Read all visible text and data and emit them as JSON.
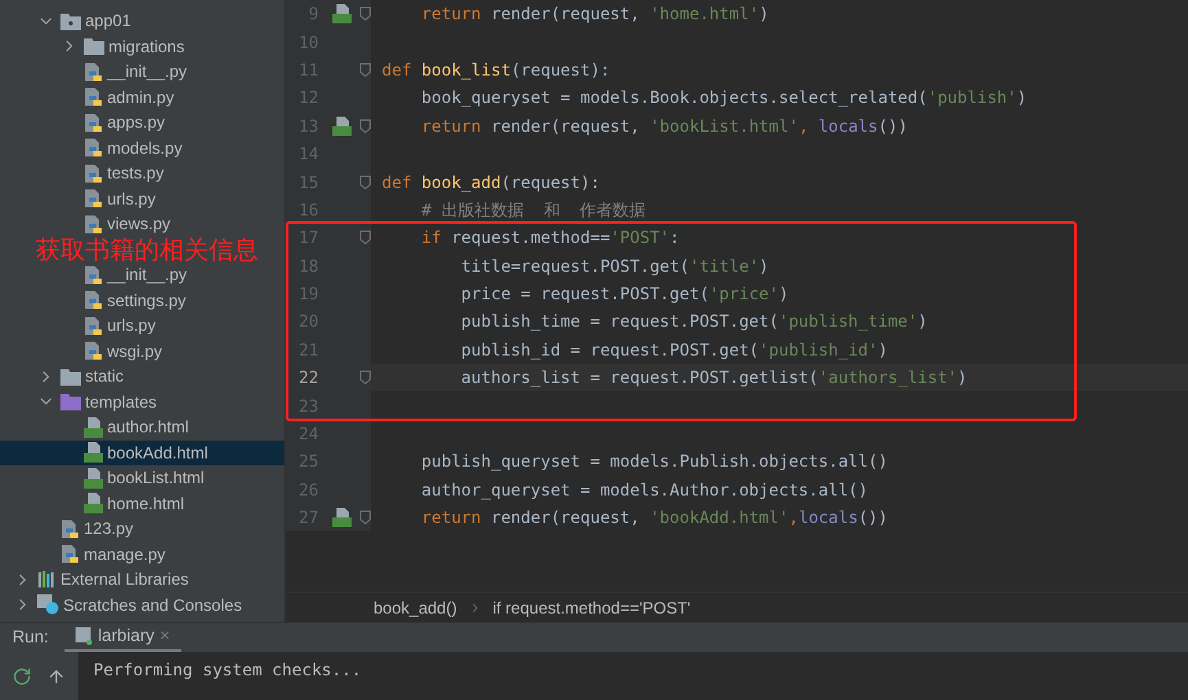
{
  "project_tree": {
    "children": [
      {
        "name": "app01",
        "kind": "package",
        "expanded": true,
        "selected": false,
        "children": [
          {
            "name": "migrations",
            "kind": "folder",
            "expanded": false,
            "selected": false
          },
          {
            "name": "__init__.py",
            "kind": "python",
            "selected": false
          },
          {
            "name": "admin.py",
            "kind": "python",
            "selected": false
          },
          {
            "name": "apps.py",
            "kind": "python",
            "selected": false
          },
          {
            "name": "models.py",
            "kind": "python",
            "selected": false
          },
          {
            "name": "tests.py",
            "kind": "python",
            "selected": false
          },
          {
            "name": "urls.py",
            "kind": "python",
            "selected": false
          },
          {
            "name": "views.py",
            "kind": "python",
            "selected": false
          }
        ]
      },
      {
        "selected": false,
        "annotation": "获取书籍的相关信息",
        "children": [
          {
            "name": "__init__.py",
            "kind": "python",
            "selected": false
          },
          {
            "name": "settings.py",
            "kind": "python",
            "selected": false
          },
          {
            "name": "urls.py",
            "kind": "python",
            "selected": false
          },
          {
            "name": "wsgi.py",
            "kind": "python",
            "selected": false
          }
        ]
      },
      {
        "name": "static",
        "kind": "folder",
        "expanded": false,
        "selected": false
      },
      {
        "name": "templates",
        "kind": "templates",
        "expanded": true,
        "selected": false,
        "children": [
          {
            "name": "author.html",
            "kind": "html",
            "selected": false
          },
          {
            "name": "bookAdd.html",
            "kind": "html",
            "selected": true
          },
          {
            "name": "bookList.html",
            "kind": "html",
            "selected": false
          },
          {
            "name": "home.html",
            "kind": "html",
            "selected": false
          }
        ]
      },
      {
        "name": "123.py",
        "kind": "python",
        "selected": false
      },
      {
        "name": "manage.py",
        "kind": "python",
        "selected": false
      }
    ]
  },
  "extra_roots": [
    {
      "name": "External Libraries",
      "kind": "libraries",
      "expanded": false,
      "selected": false
    },
    {
      "name": "Scratches and Consoles",
      "kind": "scratches",
      "expanded": false,
      "selected": false
    }
  ],
  "editor": {
    "lines": [
      {
        "number": "9",
        "gutter_icon": true,
        "fold": true,
        "current": false,
        "tokens": [
          {
            "text": "    return",
            "kind": "kw"
          },
          {
            "text": " render(request, ",
            "kind": "plain"
          },
          {
            "text": "'home.html'",
            "kind": "str"
          },
          {
            "text": ")",
            "kind": "plain"
          }
        ]
      },
      {
        "number": "10",
        "gutter_icon": false,
        "fold": false,
        "current": false
      },
      {
        "number": "11",
        "gutter_icon": false,
        "fold": true,
        "current": false,
        "tokens": [
          {
            "text": "def ",
            "kind": "kw"
          },
          {
            "text": "book_list",
            "kind": "fn"
          },
          {
            "text": "(request):",
            "kind": "plain"
          }
        ]
      },
      {
        "number": "12",
        "gutter_icon": false,
        "fold": false,
        "current": false,
        "tokens": [
          {
            "text": "    book_queryset = models.Book.objects.select_related(",
            "kind": "plain"
          },
          {
            "text": "'publish'",
            "kind": "str"
          },
          {
            "text": ")",
            "kind": "plain"
          }
        ]
      },
      {
        "number": "13",
        "gutter_icon": true,
        "fold": true,
        "current": false,
        "tokens": [
          {
            "text": "    return",
            "kind": "kw"
          },
          {
            "text": " render(request, ",
            "kind": "plain"
          },
          {
            "text": "'bookList.html'",
            "kind": "str"
          },
          {
            "text": ", ",
            "kind": "kw"
          },
          {
            "text": "locals",
            "kind": "builtin"
          },
          {
            "text": "())",
            "kind": "plain"
          }
        ]
      },
      {
        "number": "14",
        "gutter_icon": false,
        "fold": false,
        "current": false
      },
      {
        "number": "15",
        "gutter_icon": false,
        "fold": true,
        "current": false,
        "tokens": [
          {
            "text": "def ",
            "kind": "kw"
          },
          {
            "text": "book_add",
            "kind": "fn"
          },
          {
            "text": "(request):",
            "kind": "plain"
          }
        ]
      },
      {
        "number": "16",
        "gutter_icon": false,
        "fold": false,
        "current": false,
        "tokens": [
          {
            "text": "    # 出版社数据  和  作者数据",
            "kind": "comment"
          }
        ]
      },
      {
        "number": "17",
        "gutter_icon": false,
        "fold": true,
        "current": false,
        "tokens": [
          {
            "text": "    if",
            "kind": "kw"
          },
          {
            "text": " request.method==",
            "kind": "plain"
          },
          {
            "text": "'POST'",
            "kind": "str"
          },
          {
            "text": ":",
            "kind": "plain"
          }
        ]
      },
      {
        "number": "18",
        "gutter_icon": false,
        "fold": false,
        "current": false,
        "tokens": [
          {
            "text": "        title=request.POST.get(",
            "kind": "plain"
          },
          {
            "text": "'title'",
            "kind": "str"
          },
          {
            "text": ")",
            "kind": "plain"
          }
        ]
      },
      {
        "number": "19",
        "gutter_icon": false,
        "fold": false,
        "current": false,
        "tokens": [
          {
            "text": "        price = request.POST.get(",
            "kind": "plain"
          },
          {
            "text": "'price'",
            "kind": "str"
          },
          {
            "text": ")",
            "kind": "plain"
          }
        ]
      },
      {
        "number": "20",
        "gutter_icon": false,
        "fold": false,
        "current": false,
        "tokens": [
          {
            "text": "        publish_time = request.POST.get(",
            "kind": "plain"
          },
          {
            "text": "'publish_time'",
            "kind": "str"
          },
          {
            "text": ")",
            "kind": "plain"
          }
        ]
      },
      {
        "number": "21",
        "gutter_icon": false,
        "fold": false,
        "current": false,
        "tokens": [
          {
            "text": "        publish_id = request.POST.get(",
            "kind": "plain"
          },
          {
            "text": "'publish_id'",
            "kind": "str"
          },
          {
            "text": ")",
            "kind": "plain"
          }
        ]
      },
      {
        "number": "22",
        "gutter_icon": false,
        "fold": true,
        "current": true,
        "tokens": [
          {
            "text": "        authors_list = request.POST.getlist(",
            "kind": "plain"
          },
          {
            "text": "'authors_list'",
            "kind": "str"
          },
          {
            "text": ")",
            "kind": "plain"
          }
        ]
      },
      {
        "number": "23",
        "gutter_icon": false,
        "fold": false,
        "current": false
      },
      {
        "number": "24",
        "gutter_icon": false,
        "fold": false,
        "current": false
      },
      {
        "number": "25",
        "gutter_icon": false,
        "fold": false,
        "current": false,
        "tokens": [
          {
            "text": "    publish_queryset = models.Publish.objects.all()",
            "kind": "plain"
          }
        ]
      },
      {
        "number": "26",
        "gutter_icon": false,
        "fold": false,
        "current": false,
        "tokens": [
          {
            "text": "    author_queryset = models.Author.objects.all()",
            "kind": "plain"
          }
        ]
      },
      {
        "number": "27",
        "gutter_icon": true,
        "fold": true,
        "current": false,
        "tokens": [
          {
            "text": "    return",
            "kind": "kw"
          },
          {
            "text": " render(request, ",
            "kind": "plain"
          },
          {
            "text": "'bookAdd.html'",
            "kind": "str"
          },
          {
            "text": ",",
            "kind": "kw"
          },
          {
            "text": "locals",
            "kind": "builtin"
          },
          {
            "text": "())",
            "kind": "plain"
          }
        ]
      }
    ]
  },
  "breadcrumbs": [
    "book_add()",
    "if request.method=='POST'"
  ],
  "run_panel": {
    "label": "Run:",
    "tab": "larbiary",
    "close": "×",
    "console": "Performing system checks..."
  }
}
